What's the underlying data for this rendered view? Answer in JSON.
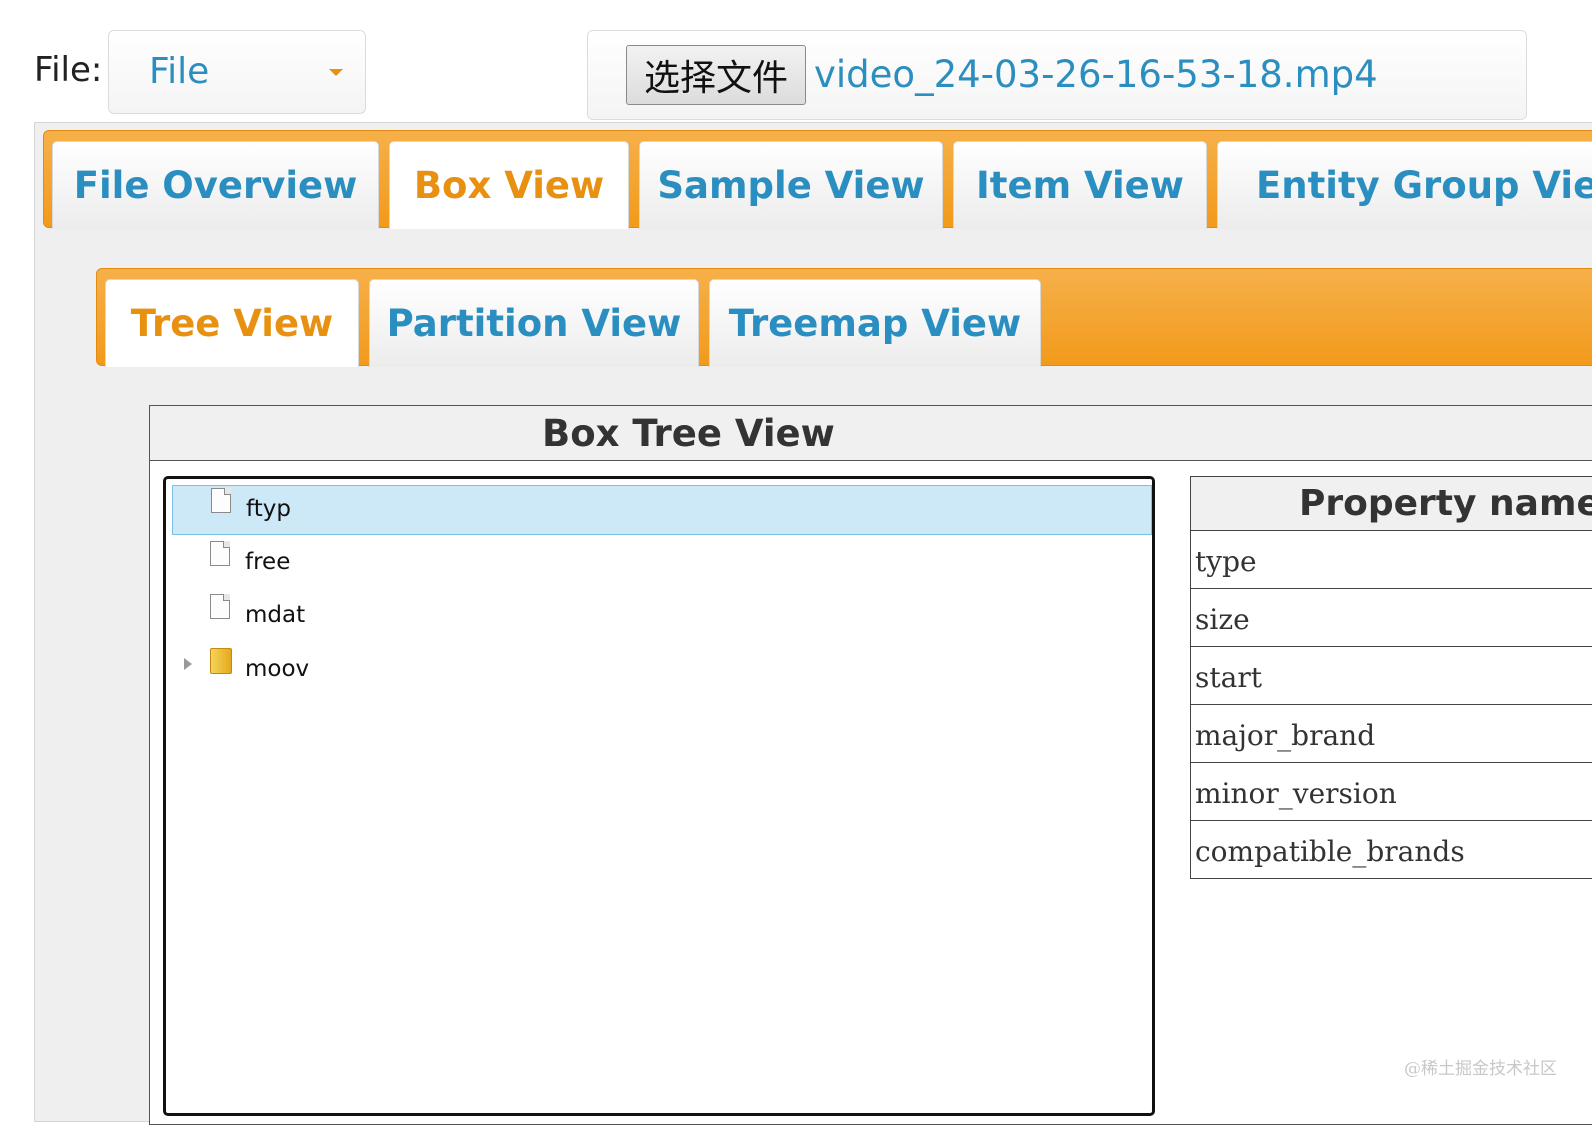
{
  "file_row": {
    "label": "File:",
    "select_value": "File",
    "choose_button": "选择文件",
    "file_name": "video_24-03-26-16-53-18.mp4"
  },
  "main_tabs": [
    {
      "label": "File Overview",
      "active": false
    },
    {
      "label": "Box View",
      "active": true
    },
    {
      "label": "Sample View",
      "active": false
    },
    {
      "label": "Item View",
      "active": false
    },
    {
      "label": "Entity Group View",
      "active": false
    }
  ],
  "sub_tabs": [
    {
      "label": "Tree View",
      "active": true
    },
    {
      "label": "Partition View",
      "active": false
    },
    {
      "label": "Treemap View",
      "active": false
    }
  ],
  "tree_panel": {
    "title": "Box Tree View",
    "nodes": [
      {
        "label": "ftyp",
        "type": "file",
        "selected": true
      },
      {
        "label": "free",
        "type": "file",
        "selected": false
      },
      {
        "label": "mdat",
        "type": "file",
        "selected": false
      },
      {
        "label": "moov",
        "type": "folder",
        "selected": false,
        "expandable": true
      }
    ]
  },
  "property_table": {
    "header": "Property name",
    "rows": [
      "type",
      "size",
      "start",
      "major_brand",
      "minor_version",
      "compatible_brands"
    ]
  },
  "watermark": "@稀土掘金技术社区",
  "colors": {
    "accent_orange": "#f29a1b",
    "link_blue": "#2a8fc0",
    "active_tab_text": "#e8900f",
    "selection_bg": "#cde8f6"
  }
}
